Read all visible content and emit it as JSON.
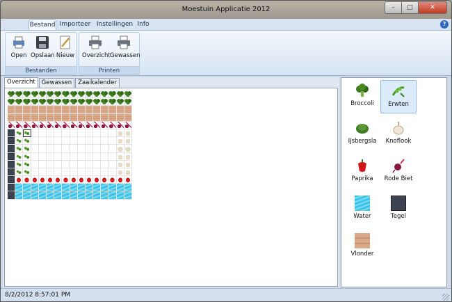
{
  "window": {
    "title": "Moestuin Applicatie 2012",
    "controls": {
      "minimize": "–",
      "maximize": "□",
      "close": "✕"
    }
  },
  "ribbon": {
    "tabs": [
      "Bestand",
      "Importeer",
      "Instellingen",
      "Info"
    ],
    "active_tab": "Bestand",
    "help": "?",
    "groups": [
      {
        "label": "Bestanden",
        "buttons": [
          "Open",
          "Opslaan",
          "Nieuw"
        ]
      },
      {
        "label": "Printen",
        "buttons": [
          "Overzicht",
          "Gewassen"
        ]
      }
    ]
  },
  "content_tabs": [
    "Overzicht",
    "Gewassen",
    "Zaaikalender"
  ],
  "active_content_tab": "Overzicht",
  "garden_grid": {
    "rows": [
      [
        "broc",
        "broc",
        "broc",
        "broc",
        "broc",
        "broc",
        "broc",
        "broc",
        "broc",
        "broc",
        "broc",
        "broc",
        "broc",
        "broc",
        "broc",
        "broc"
      ],
      [
        "broc",
        "broc",
        "broc",
        "broc",
        "broc",
        "broc",
        "broc",
        "broc",
        "broc",
        "broc",
        "broc",
        "broc",
        "broc",
        "broc",
        "broc",
        "broc"
      ],
      [
        "wood",
        "wood",
        "wood",
        "wood",
        "wood",
        "wood",
        "wood",
        "wood",
        "wood",
        "wood",
        "wood",
        "wood",
        "wood",
        "wood",
        "wood",
        "wood"
      ],
      [
        "wood",
        "wood",
        "wood",
        "wood",
        "wood",
        "wood",
        "wood",
        "wood",
        "wood",
        "wood",
        "wood",
        "wood",
        "wood",
        "wood",
        "wood",
        "wood"
      ],
      [
        "beet",
        "beet",
        "beet",
        "beet",
        "beet",
        "beet",
        "beet",
        "beet",
        "beet",
        "beet",
        "beet",
        "beet",
        "beet",
        "beet",
        "beet",
        "beet"
      ],
      [
        "tile",
        "pea",
        "pea-box",
        "",
        "",
        "",
        "",
        "",
        "",
        "",
        "",
        "",
        "",
        "",
        "garl",
        "garl"
      ],
      [
        "tile",
        "pea",
        "pea",
        "",
        "",
        "",
        "",
        "",
        "",
        "",
        "",
        "",
        "",
        "",
        "garl",
        "garl"
      ],
      [
        "tile",
        "pea",
        "pea",
        "",
        "",
        "",
        "",
        "",
        "",
        "",
        "",
        "",
        "",
        "",
        "garl",
        "garl"
      ],
      [
        "tile",
        "pea",
        "pea",
        "",
        "",
        "",
        "",
        "",
        "",
        "",
        "",
        "",
        "",
        "",
        "garl",
        "garl"
      ],
      [
        "tile",
        "pea",
        "pea",
        "",
        "",
        "",
        "",
        "",
        "",
        "",
        "",
        "",
        "",
        "",
        "garl",
        "garl"
      ],
      [
        "tile",
        "pea",
        "pea",
        "",
        "",
        "",
        "",
        "",
        "",
        "",
        "",
        "",
        "",
        "",
        "garl",
        "garl"
      ],
      [
        "tile",
        "pap",
        "pap",
        "pap",
        "pap",
        "pap",
        "pap",
        "pap",
        "pap",
        "pap",
        "pap",
        "pap",
        "pap",
        "pap",
        "pap",
        "pap"
      ],
      [
        "tile",
        "water",
        "water",
        "water",
        "water",
        "water",
        "water",
        "water",
        "water",
        "water",
        "water",
        "water",
        "water",
        "water",
        "water",
        "water"
      ],
      [
        "tile",
        "water",
        "water",
        "water",
        "water",
        "water",
        "water",
        "water",
        "water",
        "water",
        "water",
        "water",
        "water",
        "water",
        "water",
        "water"
      ]
    ]
  },
  "crop_panel": {
    "items": [
      {
        "name": "Broccoli",
        "icon": "broccoli-icon"
      },
      {
        "name": "Erwten",
        "icon": "pea-icon",
        "selected": true
      },
      {
        "name": "IJsbergsla",
        "icon": "lettuce-icon"
      },
      {
        "name": "Knoflook",
        "icon": "garlic-icon"
      },
      {
        "name": "Paprika",
        "icon": "pepper-icon"
      },
      {
        "name": "Rode Biet",
        "icon": "beet-icon"
      },
      {
        "name": "Water",
        "icon": "water-icon"
      },
      {
        "name": "Tegel",
        "icon": "tile-icon"
      },
      {
        "name": "Vlonder",
        "icon": "decking-icon"
      }
    ]
  },
  "status_bar": {
    "datetime": "8/2/2012 8:57:01 PM"
  }
}
